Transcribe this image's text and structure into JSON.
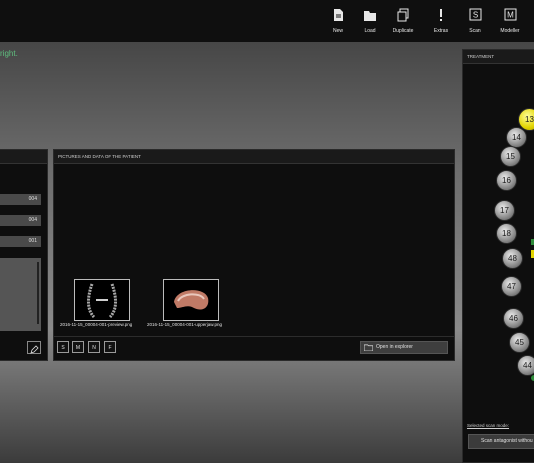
{
  "toolbar": {
    "items": [
      {
        "label": "New",
        "icon": "new-document-icon"
      },
      {
        "label": "Load",
        "icon": "folder-icon"
      },
      {
        "label": "Duplicate",
        "icon": "duplicate-icon"
      },
      {
        "label": "Extras",
        "icon": "exclamation-icon"
      },
      {
        "label": "Scan",
        "icon": "S"
      },
      {
        "label": "Modeller",
        "icon": "M"
      }
    ]
  },
  "hint": "right.",
  "left_panel": {
    "fields": [
      "004",
      "004",
      "001"
    ]
  },
  "pictures_panel": {
    "title": "PICTURES AND DATA OF THE PATIENT",
    "files": [
      {
        "caption": "2016-11-15_00004-001-preview.png"
      },
      {
        "caption": "2016-11-15_00004-001-upperjaw.png"
      }
    ],
    "size_buttons": [
      "S",
      "M",
      "N",
      "F"
    ],
    "open_button": "Open in explorer"
  },
  "treatment": {
    "title": "TREATMENT",
    "teeth": [
      "13",
      "14",
      "15",
      "16",
      "17",
      "18",
      "48",
      "47",
      "46",
      "45",
      "44"
    ],
    "selected_tooth": "13",
    "scan_mode_label": "Selected scan mode:",
    "scan_button": "Scan antagonist withou"
  },
  "colors": {
    "accent": "#e2d400",
    "hint": "#5fbf7f"
  }
}
